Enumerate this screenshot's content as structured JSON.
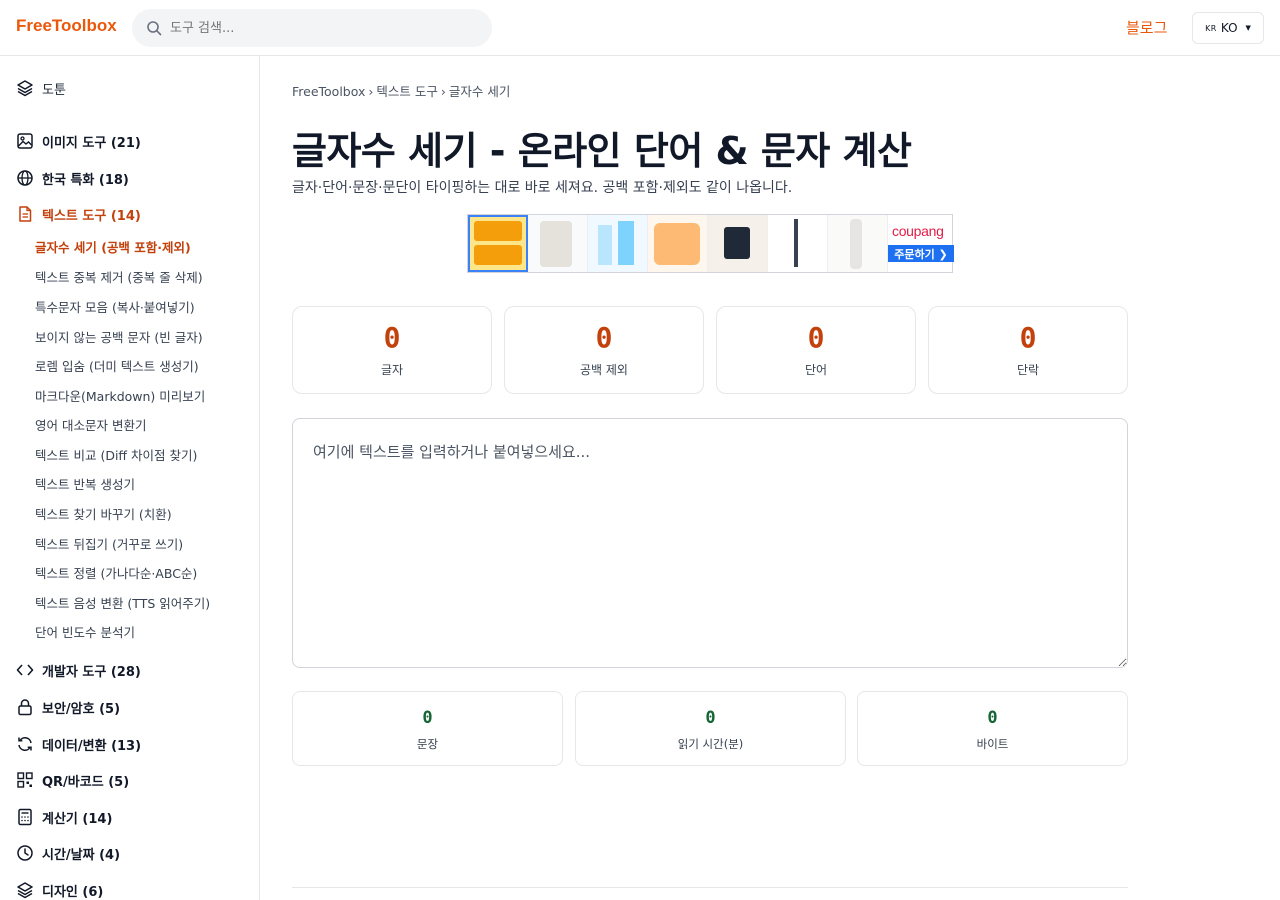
{
  "header": {
    "logo": "FreeToolbox",
    "search_placeholder": "도구 검색...",
    "blog_label": "블로그",
    "lang_flag": "KR",
    "lang_label": "KO"
  },
  "sidebar": {
    "top_item": "도툰",
    "categories": [
      {
        "label": "이미지 도구 (21)",
        "icon": "image-icon"
      },
      {
        "label": "한국 특화 (18)",
        "icon": "globe-icon"
      },
      {
        "label": "텍스트 도구 (14)",
        "icon": "document-icon"
      },
      {
        "label": "개발자 도구 (28)",
        "icon": "code-icon"
      },
      {
        "label": "보안/암호 (5)",
        "icon": "lock-icon"
      },
      {
        "label": "데이터/변환 (13)",
        "icon": "refresh-icon"
      },
      {
        "label": "QR/바코드 (5)",
        "icon": "qr-icon"
      },
      {
        "label": "계산기 (14)",
        "icon": "calculator-icon"
      },
      {
        "label": "시간/날짜 (4)",
        "icon": "clock-icon"
      },
      {
        "label": "디자인 (6)",
        "icon": "layers-icon"
      }
    ],
    "text_tools": [
      "글자수 세기 (공백 포함·제외)",
      "텍스트 중복 제거 (중복 줄 삭제)",
      "특수문자 모음 (복사·붙여넣기)",
      "보이지 않는 공백 문자 (빈 글자)",
      "로렘 입숨 (더미 텍스트 생성기)",
      "마크다운(Markdown) 미리보기",
      "영어 대소문자 변환기",
      "텍스트 비교 (Diff 차이점 찾기)",
      "텍스트 반복 생성기",
      "텍스트 찾기 바꾸기 (치환)",
      "텍스트 뒤집기 (거꾸로 쓰기)",
      "텍스트 정렬 (가나다순·ABC순)",
      "텍스트 음성 변환 (TTS 읽어주기)",
      "단어 빈도수 분석기"
    ]
  },
  "breadcrumb": [
    "FreeToolbox",
    "텍스트 도구",
    "글자수 세기"
  ],
  "breadcrumb_sep": "›",
  "page": {
    "title": "글자수 세기 - 온라인 단어 & 문자 계산",
    "subtitle": "글자·단어·문장·문단이 타이핑하는 대로 바로 세져요. 공백 포함·제외도 같이 나옵니다."
  },
  "ad": {
    "brand": "coupang",
    "cta": "주문하기 ❯"
  },
  "stats_primary": [
    {
      "value": "0",
      "label": "글자"
    },
    {
      "value": "0",
      "label": "공백 제외"
    },
    {
      "value": "0",
      "label": "단어"
    },
    {
      "value": "0",
      "label": "단락"
    }
  ],
  "textarea_placeholder": "여기에 텍스트를 입력하거나 붙여넣으세요...",
  "stats_secondary": [
    {
      "value": "0",
      "label": "문장"
    },
    {
      "value": "0",
      "label": "읽기 시간(분)"
    },
    {
      "value": "0",
      "label": "바이트"
    }
  ],
  "colors": {
    "accent": "#ea580c",
    "active": "#c2410c",
    "stat_green": "#166534"
  }
}
